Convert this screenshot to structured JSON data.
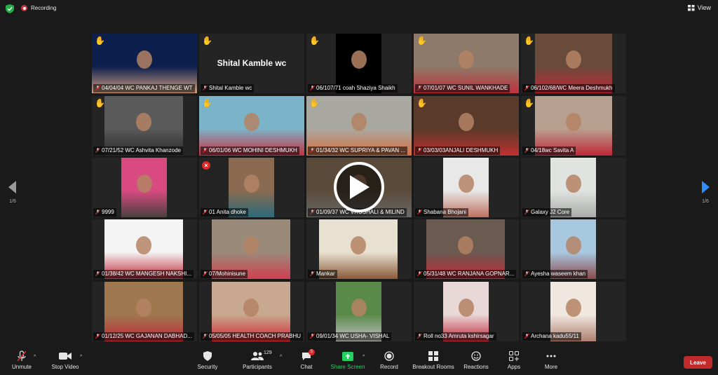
{
  "topbar": {
    "recording_label": "Recording",
    "view_label": "View"
  },
  "navigation": {
    "page_left": "1/6",
    "page_right": "1/6"
  },
  "colors": {
    "active_speaker": "#c8d83a",
    "leave": "#c02a2a",
    "share": "#23d160",
    "hand": "#f6c443",
    "muted": "#e02828"
  },
  "participants": [
    {
      "name": "04/04/04 WC PANKAJ THENGE WT",
      "hand": true,
      "video": true,
      "bg": "#0d1f4d",
      "person": "#d0a080"
    },
    {
      "name": "Shital Kamble wc",
      "hand": true,
      "video": false,
      "display_text": "Shital Kamble wc"
    },
    {
      "name": "06/107/71 coah Shaziya Shaikh",
      "hand": true,
      "video": true,
      "bg": "#000000",
      "person": "#000000"
    },
    {
      "name": "07/01/07 WC SUNIL WANKHADE",
      "hand": true,
      "video": true,
      "active": true,
      "bg": "#8e7a6a",
      "person": "#c0303a"
    },
    {
      "name": "06/102/68/WC Meera Deshmukh",
      "hand": true,
      "video": true,
      "bg": "#6a4a3a",
      "person": "#c02838"
    },
    {
      "name": "07/21/52 WC Ashvita Khanzode",
      "hand": true,
      "video": true,
      "bg": "#5a5a5a",
      "person": "#2a2a2a"
    },
    {
      "name": "06/01/06 WC MOHINI DESHMUKH",
      "hand": true,
      "video": true,
      "bg": "#7bb3c8",
      "person": "#c83040"
    },
    {
      "name": "01/34/32 WC SUPRIYA & PAVAN ...",
      "hand": true,
      "video": true,
      "bg": "#a8a8a0",
      "person": "#d87040"
    },
    {
      "name": "03/03/03ANJALI DESHMUKH",
      "hand": true,
      "video": true,
      "bg": "#5a3a2a",
      "person": "#c03030"
    },
    {
      "name": "04/18wc Savita A",
      "hand": true,
      "video": true,
      "bg": "#b8a090",
      "person": "#c02838"
    },
    {
      "name": "9999",
      "hand": false,
      "video": true,
      "bg": "#d84a80",
      "person": "#4a4040"
    },
    {
      "name": "01 Anita dhoke",
      "hand": false,
      "muted_badge": true,
      "video": true,
      "bg": "#8a6a50",
      "person": "#2a6a7a"
    },
    {
      "name": "01/09/37 WC VRUSHALI & MILIND",
      "hand": false,
      "video": true,
      "bg": "#5a4a3a",
      "person": "#6a6a6a"
    },
    {
      "name": "Shabana Bhojani",
      "hand": false,
      "video": true,
      "bg": "#e8e8e8",
      "person": "#c07060"
    },
    {
      "name": "Galaxy J2 Core",
      "hand": false,
      "video": true,
      "bg": "#e0e4e0",
      "person": "#aaaaaa"
    },
    {
      "name": "01/38/42 WC MANGESH NAKSHI...",
      "hand": false,
      "video": true,
      "bg": "#f4f4f4",
      "person": "#c02838"
    },
    {
      "name": "07/Mohinisune",
      "hand": false,
      "video": true,
      "bg": "#9a8a7a",
      "person": "#d04050"
    },
    {
      "name": "Mankar",
      "hand": false,
      "video": true,
      "bg": "#e8e0d0",
      "person": "#8a5a3a"
    },
    {
      "name": "05/31/48 WC RANJANA GOPNAR...",
      "hand": false,
      "video": true,
      "bg": "#6a5a50",
      "person": "#c02838"
    },
    {
      "name": "Ayesha waseem khan",
      "hand": false,
      "video": true,
      "bg": "#a8c8e0",
      "person": "#8a4a4a"
    },
    {
      "name": "01/12/25 WC GAJANAN DABHAD...",
      "hand": false,
      "video": true,
      "bg": "#a07850",
      "person": "#c02838"
    },
    {
      "name": "05/05/05 HEALTH COACH PRABHU",
      "hand": false,
      "video": true,
      "bg": "#c8a890",
      "person": "#d02830"
    },
    {
      "name": "09/01/34 WC USHA- VISHAL",
      "hand": false,
      "video": true,
      "bg": "#5a8a4a",
      "person": "#c0c0c0"
    },
    {
      "name": "Roll no33 Amruta kshirsagar",
      "hand": false,
      "video": true,
      "bg": "#e8d8d8",
      "person": "#c02838"
    },
    {
      "name": "Archana kadu55/11",
      "hand": false,
      "video": true,
      "bg": "#f0e8e0",
      "person": "#b08070"
    }
  ],
  "toolbar": {
    "unmute": "Unmute",
    "stop_video": "Stop Video",
    "security": "Security",
    "participants": "Participants",
    "participants_count": "129",
    "chat": "Chat",
    "chat_badge": "5",
    "share_screen": "Share Screen",
    "record": "Record",
    "breakout_rooms": "Breakout Rooms",
    "reactions": "Reactions",
    "apps": "Apps",
    "more": "More",
    "leave": "Leave"
  }
}
